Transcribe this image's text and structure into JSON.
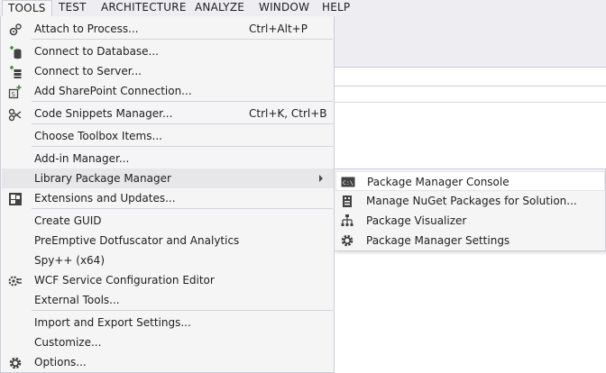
{
  "menubar": {
    "items": [
      "TOOLS",
      "TEST",
      "ARCHITECTURE",
      "ANALYZE",
      "WINDOW",
      "HELP"
    ],
    "active": "TOOLS"
  },
  "tools_menu": {
    "items": [
      {
        "label": "Attach to Process...",
        "shortcut": "Ctrl+Alt+P",
        "icon": "attach-process-icon"
      },
      {
        "label": "Connect to Database...",
        "icon": "connect-database-icon"
      },
      {
        "label": "Connect to Server...",
        "icon": "connect-server-icon"
      },
      {
        "label": "Add SharePoint Connection...",
        "icon": "sharepoint-icon"
      },
      {
        "label": "Code Snippets Manager...",
        "shortcut": "Ctrl+K, Ctrl+B",
        "icon": "code-snippets-icon"
      },
      {
        "label": "Choose Toolbox Items..."
      },
      {
        "label": "Add-in Manager..."
      },
      {
        "label": "Library Package Manager",
        "submenu": true
      },
      {
        "label": "Extensions and Updates...",
        "icon": "extensions-icon"
      },
      {
        "label": "Create GUID"
      },
      {
        "label": "PreEmptive Dotfuscator and Analytics"
      },
      {
        "label": "Spy++ (x64)"
      },
      {
        "label": "WCF Service Configuration Editor",
        "icon": "wcf-config-icon"
      },
      {
        "label": "External Tools..."
      },
      {
        "label": "Import and Export Settings..."
      },
      {
        "label": "Customize..."
      },
      {
        "label": "Options...",
        "icon": "gear-icon"
      }
    ]
  },
  "submenu": {
    "items": [
      {
        "label": "Package Manager Console",
        "icon": "console-icon"
      },
      {
        "label": "Manage NuGet Packages for Solution...",
        "icon": "nuget-packages-icon"
      },
      {
        "label": "Package Visualizer",
        "icon": "hierarchy-icon"
      },
      {
        "label": "Package Manager Settings",
        "icon": "gear-icon"
      }
    ]
  },
  "colors": {
    "menubar_bg": "#eeeef2",
    "menu_bg": "#f5f5f5",
    "menu_border": "#cccedb",
    "highlight": "#e7e7ea",
    "text": "#1e1e1e"
  }
}
